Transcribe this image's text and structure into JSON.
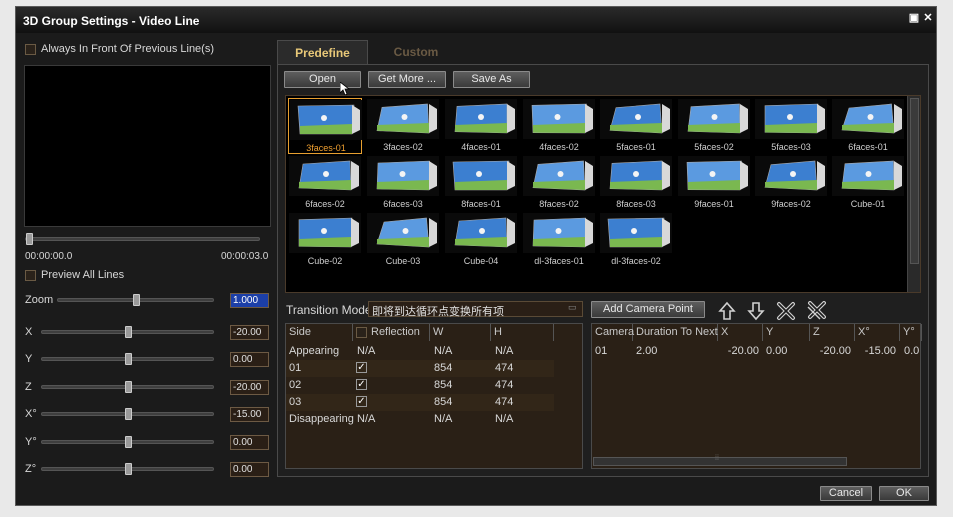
{
  "window": {
    "title": "3D Group Settings - Video Line"
  },
  "left": {
    "always_front_label": "Always In Front Of Previous Line(s)",
    "time_start": "00:00:00.0",
    "time_end": "00:00:03.0",
    "preview_all_label": "Preview All Lines",
    "params": [
      {
        "label": "Zoom",
        "value": "1.000",
        "level": 0.5
      },
      {
        "label": "X",
        "value": "-20.00",
        "level": 0.5
      },
      {
        "label": "Y",
        "value": "0.00",
        "level": 0.5
      },
      {
        "label": "Z",
        "value": "-20.00",
        "level": 0.5
      },
      {
        "label": "X°",
        "value": "-15.00",
        "level": 0.5
      },
      {
        "label": "Y°",
        "value": "0.00",
        "level": 0.5
      },
      {
        "label": "Z°",
        "value": "0.00",
        "level": 0.5
      }
    ]
  },
  "tabs": {
    "predefine": "Predefine",
    "custom": "Custom"
  },
  "toolbar": {
    "open": "Open",
    "get_more": "Get More ...",
    "save_as": "Save As"
  },
  "gallery": {
    "selected": "3faces-01",
    "items": [
      "3faces-01",
      "3faces-02",
      "4faces-01",
      "4faces-02",
      "5faces-01",
      "5faces-02",
      "5faces-03",
      "6faces-01",
      "6faces-02",
      "6faces-03",
      "8faces-01",
      "8faces-02",
      "8faces-03",
      "9faces-01",
      "9faces-02",
      "Cube-01",
      "Cube-02",
      "Cube-03",
      "Cube-04",
      "dl-3faces-01",
      "dl-3faces-02"
    ]
  },
  "transition": {
    "label": "Transition Mode",
    "value": "即将到达循环点变换所有项"
  },
  "camera_controls": {
    "add_camera_point": "Add Camera Point"
  },
  "sides_table": {
    "headers": [
      "Side",
      "Reflection",
      "W",
      "H"
    ],
    "rows": [
      {
        "side": "Appearing",
        "reflection": "N/A",
        "checked": false,
        "w": "N/A",
        "h": "N/A"
      },
      {
        "side": "01",
        "reflection": "",
        "checked": true,
        "w": "854",
        "h": "474"
      },
      {
        "side": "02",
        "reflection": "",
        "checked": true,
        "w": "854",
        "h": "474"
      },
      {
        "side": "03",
        "reflection": "",
        "checked": true,
        "w": "854",
        "h": "474"
      },
      {
        "side": "Disappearing",
        "reflection": "N/A",
        "checked": false,
        "w": "N/A",
        "h": "N/A"
      }
    ]
  },
  "camera_table": {
    "headers": [
      "Camera",
      "Duration To Next",
      "X",
      "Y",
      "Z",
      "X°",
      "Y°"
    ],
    "rows": [
      {
        "camera": "01",
        "duration": "2.00",
        "x": "-20.00",
        "y": "0.00",
        "z": "-20.00",
        "xr": "-15.00",
        "yr": "0.0"
      }
    ]
  },
  "footer": {
    "cancel": "Cancel",
    "ok": "OK"
  },
  "colors": {
    "accent": "#f0a030",
    "tab_active": "#e8c878",
    "grid_bg": "#2a2016"
  }
}
